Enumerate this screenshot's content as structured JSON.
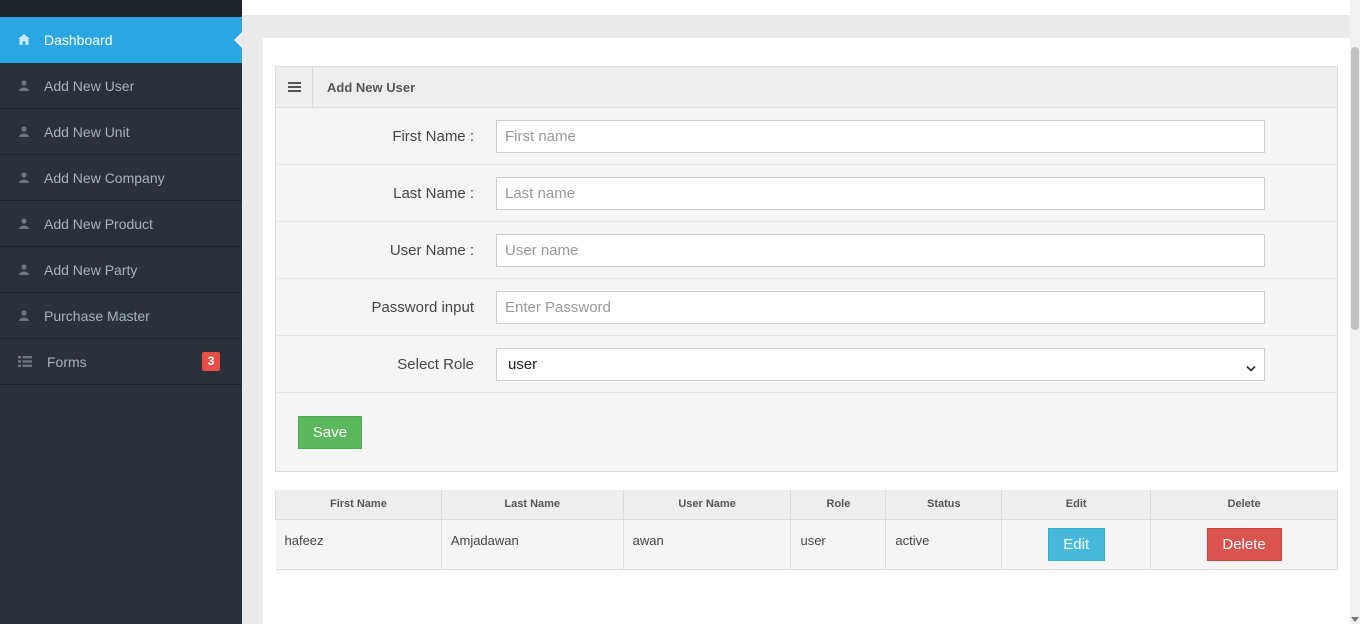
{
  "sidebar": {
    "items": [
      {
        "label": "Dashboard",
        "icon": "home-icon",
        "active": true
      },
      {
        "label": "Add New User",
        "icon": "user-icon"
      },
      {
        "label": "Add New Unit",
        "icon": "user-icon"
      },
      {
        "label": "Add New Company",
        "icon": "user-icon"
      },
      {
        "label": "Add New Product",
        "icon": "user-icon"
      },
      {
        "label": "Add New Party",
        "icon": "user-icon"
      },
      {
        "label": "Purchase Master",
        "icon": "user-icon"
      },
      {
        "label": "Forms",
        "icon": "list-icon",
        "badge": "3"
      }
    ]
  },
  "panel": {
    "title": "Add New User",
    "fields": {
      "first_name": {
        "label": "First Name :",
        "placeholder": "First name",
        "value": ""
      },
      "last_name": {
        "label": "Last Name :",
        "placeholder": "Last name",
        "value": ""
      },
      "user_name": {
        "label": "User Name :",
        "placeholder": "User name",
        "value": ""
      },
      "password": {
        "label": "Password input",
        "placeholder": "Enter Password",
        "value": ""
      },
      "role": {
        "label": "Select Role",
        "selected": "user"
      }
    },
    "save_label": "Save"
  },
  "table": {
    "headers": [
      "First Name",
      "Last Name",
      "User Name",
      "Role",
      "Status",
      "Edit",
      "Delete"
    ],
    "rows": [
      {
        "first_name": "hafeez",
        "last_name": "Amjadawan",
        "user_name": "awan",
        "role": "user",
        "status": "active",
        "edit_label": "Edit",
        "delete_label": "Delete"
      }
    ]
  },
  "colors": {
    "sidebar_bg": "#2a3139",
    "active_bg": "#2aa7e2",
    "save": "#5cb85c",
    "edit": "#46b8da",
    "delete": "#d9534f",
    "badge": "#e84e47"
  }
}
